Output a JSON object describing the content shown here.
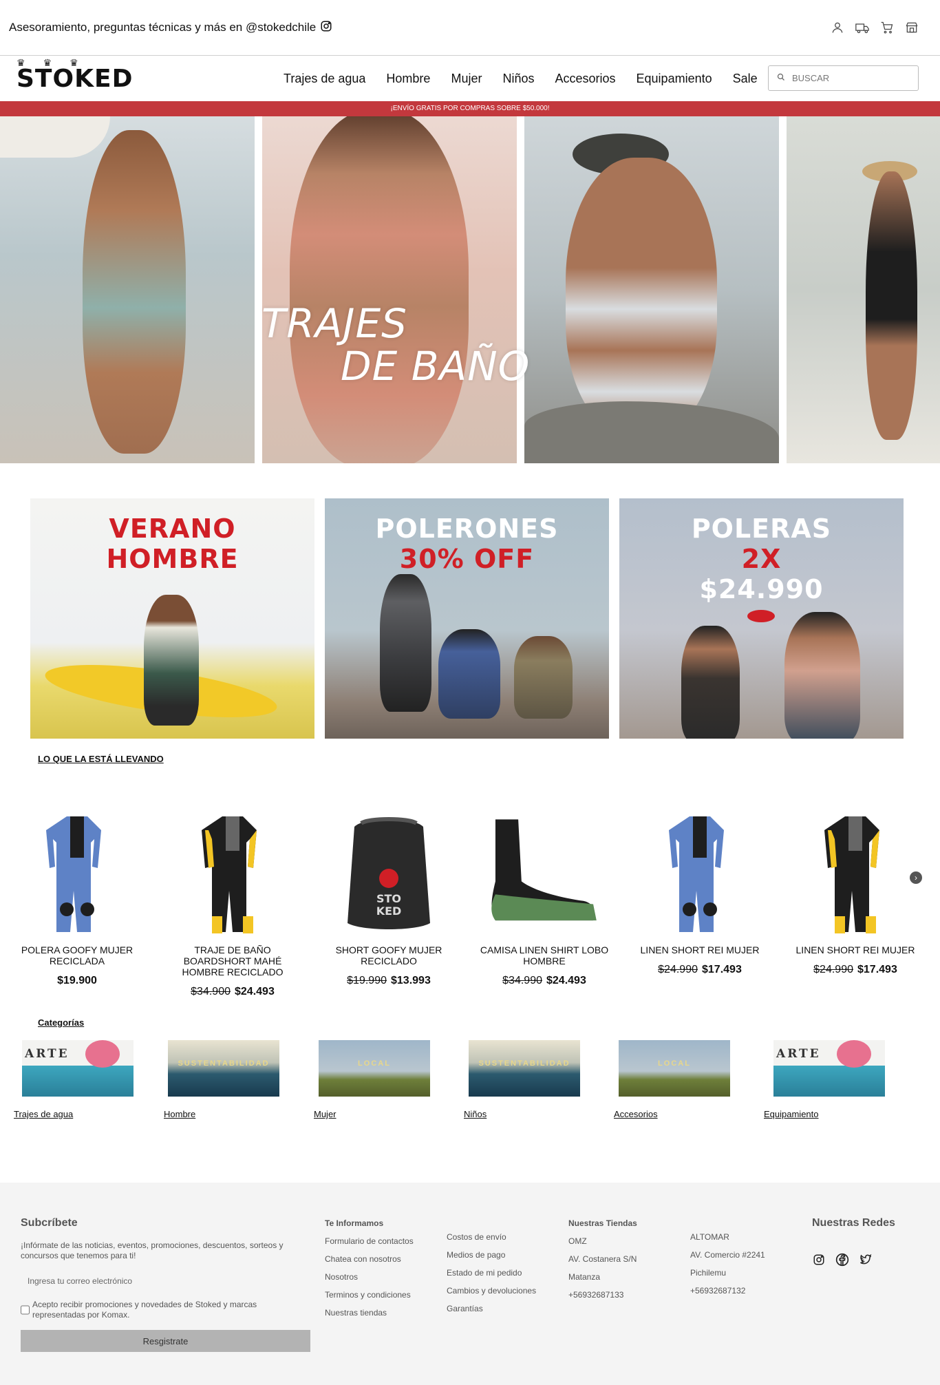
{
  "topbar": {
    "text": "Asesoramiento, preguntas técnicas y más en @stokedchile",
    "icons": [
      "instagram-icon",
      "user-icon",
      "truck-icon",
      "cart-icon",
      "store-icon"
    ]
  },
  "nav": {
    "logo": "STOKED",
    "menu": [
      "Trajes de agua",
      "Hombre",
      "Mujer",
      "Niños",
      "Accesorios",
      "Equipamiento",
      "Sale"
    ],
    "search_placeholder": "BUSCAR"
  },
  "promo_strip": "¡ENVÍO GRATIS POR COMPRAS SOBRE $50.000!",
  "hero": {
    "title_line1": "TRAJES",
    "title_line2": "DE BAÑO"
  },
  "banners": [
    {
      "line1": "VERANO",
      "line2": "HOMBRE",
      "line3": ""
    },
    {
      "line1": "POLERONES",
      "line2": "30% OFF",
      "line3": ""
    },
    {
      "line1": "POLERAS",
      "line2": "2X",
      "line3": "$24.990"
    }
  ],
  "featured_heading": "LO QUE LA ESTÁ LLEVANDO",
  "products": [
    {
      "name": "POLERA GOOFY MUJER RECICLADA",
      "old_price": "",
      "price": "$19.900",
      "image": "wetsuit-blue-icon"
    },
    {
      "name": "TRAJE DE BAÑO BOARDSHORT MAHÉ HOMBRE RECICLADO",
      "old_price": "$34.900",
      "price": "$24.493",
      "image": "wetsuit-yellow-icon"
    },
    {
      "name": "SHORT GOOFY MUJER RECICLADO",
      "old_price": "$19.990",
      "price": "$13.993",
      "image": "backpack-icon"
    },
    {
      "name": "CAMISA LINEN SHIRT LOBO HOMBRE",
      "old_price": "$34.990",
      "price": "$24.493",
      "image": "boot-icon"
    },
    {
      "name": "LINEN SHORT REI MUJER",
      "old_price": "$24.990",
      "price": "$17.493",
      "image": "wetsuit-blue-icon"
    },
    {
      "name": "LINEN SHORT REI MUJER",
      "old_price": "$24.990",
      "price": "$17.493",
      "image": "wetsuit-yellow-icon"
    }
  ],
  "categories_heading": "Categorías",
  "categories": [
    {
      "label": "Trajes de agua",
      "thumb": "arte"
    },
    {
      "label": "Hombre",
      "thumb": "sustentabilidad"
    },
    {
      "label": "Mujer",
      "thumb": "local"
    },
    {
      "label": "Niños",
      "thumb": "sustentabilidad"
    },
    {
      "label": "Accesorios",
      "thumb": "local"
    },
    {
      "label": "Equipamiento",
      "thumb": "arte"
    }
  ],
  "thumb_texts": {
    "arte": "ARTE",
    "sustentabilidad": "SUSTENTABILIDAD",
    "local": "LOCAL"
  },
  "footer": {
    "subscribe_title": "Subcríbete",
    "subscribe_desc": "¡Infórmate de las noticias, eventos, promociones, descuentos, sorteos y concursos que tenemos para ti!",
    "email_placeholder": "Ingresa tu correo electrónico",
    "consent": "Acepto recibir promociones y novedades de Stoked y marcas representadas por Komax.",
    "register_button": "Resgistrate",
    "info_title": "Te Informamos",
    "info_links": [
      "Formulario de contactos",
      "Chatea con nosotros",
      "Nosotros",
      "Terminos y condiciones",
      "Nuestras tiendas"
    ],
    "info_links2": [
      "Costos de envío",
      "Medios de pago",
      "Estado de mi pedido",
      "Cambios y devoluciones",
      "Garantías"
    ],
    "stores_title": "Nuestras Tiendas",
    "store1": [
      "OMZ",
      "AV. Costanera S/N",
      "Matanza",
      "+56932687133"
    ],
    "store2": [
      "ALTOMAR",
      "AV. Comercio #2241",
      "Pichilemu",
      "+56932687132"
    ],
    "social_title": "Nuestras Redes",
    "social_icons": [
      "instagram-icon",
      "facebook-icon",
      "twitter-icon"
    ]
  },
  "colors": {
    "promo_red": "#c3383d",
    "banner_red": "#d01f26",
    "footer_bg": "#f4f4f4",
    "button_gray": "#b3b3b3"
  }
}
